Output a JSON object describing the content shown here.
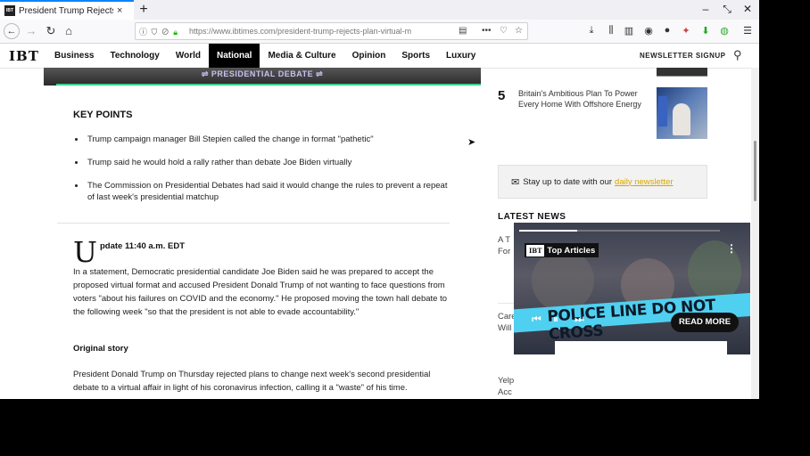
{
  "browser": {
    "tab_title": "President Trump Rejects",
    "tab_favicon": "IBT",
    "url": "https://www.ibtimes.com/president-trump-rejects-plan-virtual-m",
    "new_tab_glyph": "+"
  },
  "site": {
    "logo": "IBT",
    "nav": [
      "Business",
      "Technology",
      "World",
      "National",
      "Media & Culture",
      "Opinion",
      "Sports",
      "Luxury"
    ],
    "active_nav": "National",
    "newsletter_signup": "NEWSLETTER SIGNUP"
  },
  "article": {
    "hero_label": "PRESIDENTIAL DEBATE",
    "key_points_heading": "KEY POINTS",
    "key_points": [
      "Trump campaign manager Bill Stepien called the change in format \"pathetic\"",
      "Trump said he would hold a rally rather than debate Joe Biden virtually",
      "The Commission on Presidential Debates had said it would change the rules to prevent a repeat of last week's presidential matchup"
    ],
    "dropcap": "U",
    "update_line": "pdate 11:40 a.m. EDT",
    "update_paragraph": "In a statement, Democratic presidential candidate Joe Biden said he was prepared to accept the proposed virtual format and accused President Donald Trump of not wanting to face questions from voters \"about his failures on COVID and the economy.\" He proposed moving the town hall debate to the following week \"so that the president is not able to evade accountability.\"",
    "original_story_heading": "Original story",
    "original_paragraph": "President Donald Trump on Thursday rejected plans to change next week's second presidential debate to a virtual affair in light of his coronavirus infection, calling it a \"waste\" of his time."
  },
  "sidebar": {
    "trending_item": {
      "rank": "5",
      "title": "Britain's Ambitious Plan To Power Every Home With Offshore Energy"
    },
    "newsletter": {
      "text": "Stay up to date with our",
      "link": "daily newsletter"
    },
    "latest_news_heading": "LATEST NEWS",
    "latest_fragments": [
      {
        "line1": "A T",
        "line2": "For"
      },
      {
        "line1": "Care",
        "line2": "Will"
      },
      {
        "line1": "Yelp",
        "line2": "Acc"
      }
    ]
  },
  "video": {
    "badge_logo": "IBT",
    "badge_title": "Top Articles",
    "read_more": "READ MORE",
    "tape_text": "POLICE LINE DO NOT CROSS",
    "progress": 0.29
  }
}
